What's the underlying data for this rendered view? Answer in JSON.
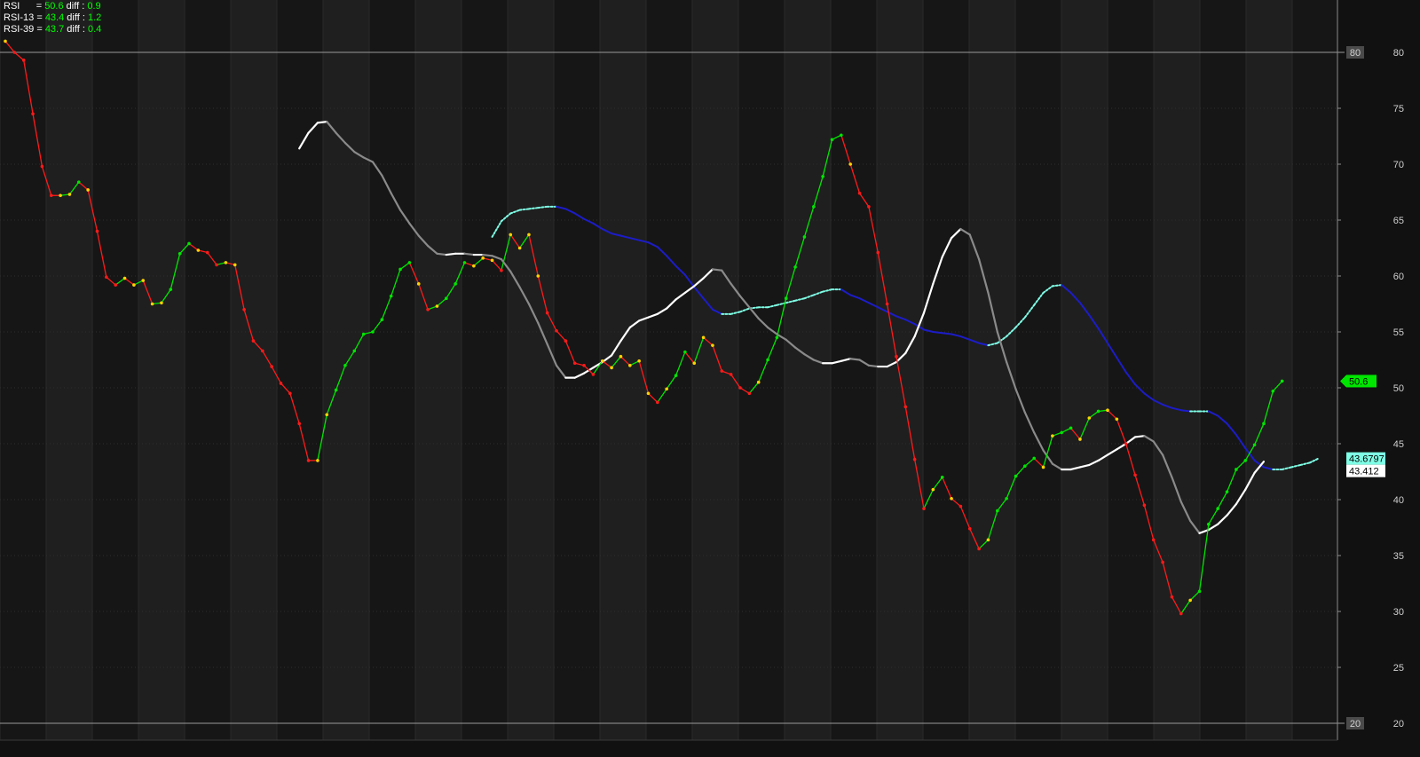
{
  "legend": {
    "rows": [
      {
        "name": "RSI",
        "eq": "=",
        "value": "50.6",
        "diff_label": "diff :",
        "diff": "0.9"
      },
      {
        "name": "RSI-13",
        "eq": "=",
        "value": "43.4",
        "diff_label": "diff :",
        "diff": "1.2"
      },
      {
        "name": "RSI-39",
        "eq": "=",
        "value": "43.7",
        "diff_label": "diff :",
        "diff": "0.4"
      }
    ]
  },
  "colors": {
    "background": "#111111",
    "band_dark": "#161616",
    "band_light": "#1f1f1f",
    "up": "#00e600",
    "down": "#ff1a1a",
    "neutral": "#ffd400",
    "rsi13_rising": "#ffffff",
    "rsi13_falling": "#8a8a8a",
    "rsi39_rising": "#7fffe6",
    "rsi39_falling": "#1c1cc8",
    "level_line": "#9a9a9a",
    "grid": "#2e2e2e"
  },
  "price_tags": [
    {
      "text": "50.6",
      "value": 50.6,
      "bg": "#00e600",
      "fg": "#000000",
      "arrow": true
    },
    {
      "text": "43.6797",
      "value": 43.6797,
      "bg": "#7fffe6",
      "fg": "#000000",
      "arrow": false
    },
    {
      "text": "43.412",
      "value": 43.412,
      "bg": "#ffffff",
      "fg": "#000000",
      "arrow": false
    }
  ],
  "level_tags": [
    {
      "text": "80",
      "value": 80
    },
    {
      "text": "20",
      "value": 20
    }
  ],
  "chart_data": {
    "type": "line",
    "title": "",
    "xlabel": "",
    "ylabel": "",
    "ylim": [
      20,
      85
    ],
    "yticks": [
      20,
      25,
      30,
      35,
      40,
      45,
      50,
      55,
      60,
      65,
      70,
      75,
      80
    ],
    "ytick_labels": [
      "20",
      "25",
      "30",
      "35",
      "40",
      "45",
      "50",
      "55",
      "60",
      "65",
      "70",
      "75",
      "80"
    ],
    "levels": [
      80,
      20
    ],
    "grid": true,
    "x_count": 140,
    "series": [
      {
        "name": "RSI",
        "style": "colored-by-direction",
        "values": [
          81.0,
          80.0,
          79.3,
          74.5,
          69.8,
          67.2,
          67.2,
          67.3,
          68.4,
          67.7,
          64.0,
          59.9,
          59.2,
          59.8,
          59.2,
          59.6,
          57.5,
          57.6,
          58.8,
          62.0,
          62.9,
          62.3,
          62.1,
          61.0,
          61.2,
          61.0,
          57.0,
          54.2,
          53.3,
          51.9,
          50.4,
          49.5,
          46.8,
          43.5,
          43.5,
          47.6,
          49.8,
          52.0,
          53.3,
          54.8,
          55.0,
          56.1,
          58.2,
          60.6,
          61.2,
          59.3,
          57.0,
          57.3,
          58.0,
          59.3,
          61.2,
          60.9,
          61.6,
          61.4,
          60.5,
          63.7,
          62.5,
          63.7,
          60.0,
          56.7,
          55.1,
          54.2,
          52.2,
          52.0,
          51.2,
          52.4,
          51.8,
          52.8,
          52.0,
          52.4,
          49.5,
          48.7,
          49.9,
          51.1,
          53.2,
          52.2,
          54.5,
          53.8,
          51.5,
          51.2,
          50.0,
          49.5,
          50.5,
          52.5,
          54.5,
          58.0,
          60.8,
          63.5,
          66.2,
          68.9,
          72.2,
          72.6,
          70.0,
          67.4,
          66.2,
          62.1,
          57.5,
          52.8,
          48.3,
          43.6,
          39.2,
          40.9,
          42.0,
          40.1,
          39.4,
          37.4,
          35.6,
          36.4,
          39.0,
          40.1,
          42.1,
          43.0,
          43.7,
          42.9,
          45.7,
          46.0,
          46.4,
          45.4,
          47.3,
          47.9,
          48.0,
          47.2,
          45.0,
          42.2,
          39.5,
          36.4,
          34.4,
          31.3,
          29.8,
          31.0,
          31.8,
          37.8,
          39.2,
          40.7,
          42.7,
          43.5,
          44.9,
          46.8,
          49.7,
          50.6
        ]
      },
      {
        "name": "RSI-13",
        "style": "white-rising-gray-falling",
        "values": [
          71.4,
          72.8,
          73.7,
          73.8,
          72.8,
          71.9,
          71.1,
          70.6,
          70.2,
          69.0,
          67.4,
          65.9,
          64.7,
          63.6,
          62.7,
          62.0,
          61.9,
          62.0,
          62.0,
          61.9,
          61.9,
          61.8,
          61.5,
          60.4,
          59.0,
          57.5,
          55.8,
          53.9,
          52.0,
          50.9,
          50.9,
          51.3,
          51.8,
          52.3,
          52.9,
          54.2,
          55.4,
          56.0,
          56.3,
          56.6,
          57.1,
          57.9,
          58.5,
          59.1,
          59.8,
          60.6,
          60.5,
          59.3,
          58.2,
          57.2,
          56.2,
          55.4,
          54.8,
          54.3,
          53.6,
          53.0,
          52.5,
          52.2,
          52.2,
          52.4,
          52.6,
          52.5,
          52.0,
          51.9,
          51.9,
          52.3,
          53.1,
          54.6,
          56.7,
          59.3,
          61.7,
          63.4,
          64.2,
          63.7,
          61.5,
          58.5,
          55.0,
          52.3,
          49.9,
          47.8,
          46.0,
          44.4,
          43.2,
          42.7,
          42.7,
          42.9,
          43.1,
          43.5,
          44.0,
          44.5,
          45.0,
          45.6,
          45.7,
          45.2,
          44.0,
          42.0,
          39.8,
          38.1,
          37.0,
          37.3,
          37.8,
          38.6,
          39.6,
          40.9,
          42.4,
          43.4
        ]
      },
      {
        "name": "RSI-39",
        "style": "dotted-cyan-rising-blue-falling",
        "values": [
          63.5,
          64.9,
          65.6,
          65.9,
          66.0,
          66.1,
          66.2,
          66.2,
          66.0,
          65.6,
          65.1,
          64.7,
          64.2,
          63.8,
          63.6,
          63.4,
          63.2,
          63.0,
          62.6,
          61.8,
          60.9,
          60.1,
          59.0,
          58.0,
          57.0,
          56.6,
          56.6,
          56.8,
          57.1,
          57.2,
          57.2,
          57.4,
          57.6,
          57.8,
          58.0,
          58.3,
          58.6,
          58.8,
          58.8,
          58.3,
          58.0,
          57.6,
          57.2,
          56.8,
          56.4,
          56.1,
          55.7,
          55.2,
          55.0,
          54.9,
          54.8,
          54.6,
          54.3,
          54.0,
          53.8,
          54.0,
          54.6,
          55.4,
          56.3,
          57.4,
          58.5,
          59.1,
          59.2,
          58.5,
          57.6,
          56.5,
          55.3,
          54.0,
          52.7,
          51.4,
          50.3,
          49.5,
          48.9,
          48.5,
          48.2,
          48.0,
          47.9,
          47.9,
          47.9,
          47.5,
          46.8,
          45.8,
          44.6,
          43.5,
          42.9,
          42.7,
          42.7,
          42.9,
          43.1,
          43.3,
          43.7
        ]
      }
    ]
  }
}
